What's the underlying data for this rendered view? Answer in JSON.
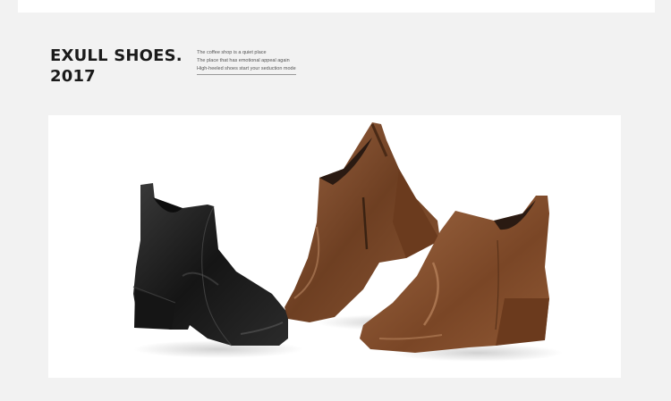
{
  "header": {
    "title_line1": "EXULL SHOES.",
    "title_line2": "2017",
    "taglines": [
      "The coffee shop is a quiet place",
      "The place that has emotional appeal again",
      "High-heeled shoes start your seduction mode"
    ]
  },
  "product_image": {
    "items": [
      {
        "icon": "black-ankle-boot-icon",
        "color": "#1e1e1e"
      },
      {
        "icon": "brown-ankle-boot-side-icon",
        "color": "#7a4a2c"
      },
      {
        "icon": "brown-ankle-boot-front-icon",
        "color": "#8a5431"
      }
    ]
  },
  "colors": {
    "background": "#f2f2f2",
    "panel": "#ffffff",
    "title": "#1a1a1a"
  }
}
